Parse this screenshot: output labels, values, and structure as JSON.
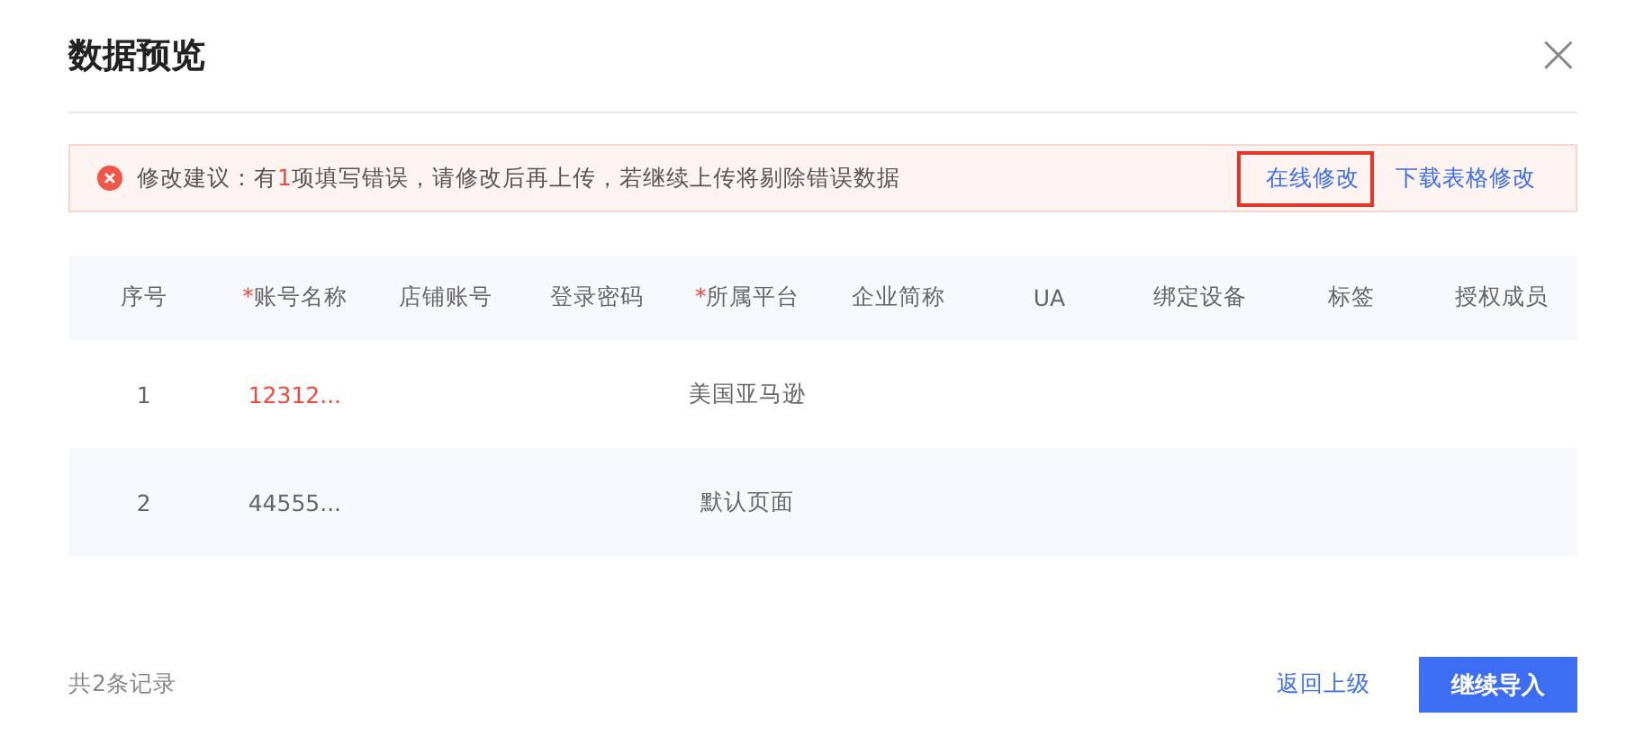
{
  "dialog": {
    "title": "数据预览",
    "close": "×"
  },
  "alert": {
    "message_prefix": "修改建议：有",
    "error_count": "1",
    "message_suffix": "项填写错误，请修改后再上传，若继续上传将剔除错误数据",
    "links": [
      {
        "label": "在线修改",
        "highlighted": true
      },
      {
        "label": "下载表格修改",
        "highlighted": false
      }
    ]
  },
  "table": {
    "columns": [
      {
        "label": "序号"
      },
      {
        "label": "账号名称",
        "required_mark": "*"
      },
      {
        "label": "店铺账号"
      },
      {
        "label": "登录密码"
      },
      {
        "label": "所属平台",
        "required_mark": "*"
      },
      {
        "label": "企业简称"
      },
      {
        "label": "UA"
      },
      {
        "label": "绑定设备"
      },
      {
        "label": "标签"
      },
      {
        "label": "授权成员"
      }
    ],
    "rows": [
      {
        "index": "1",
        "account_name": "12312...",
        "account_error": true,
        "platform": "美国亚马逊"
      },
      {
        "index": "2",
        "account_name": "44555...",
        "account_error": false,
        "platform": "默认页面"
      }
    ]
  },
  "footer": {
    "record_count": "共2条记录",
    "back": "返回上级",
    "continue": "继续导入"
  }
}
